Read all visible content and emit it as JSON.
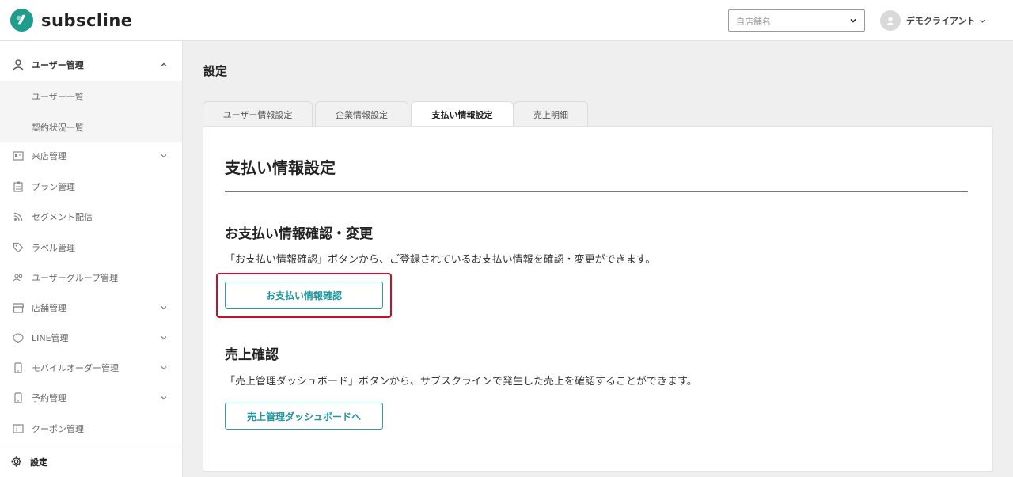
{
  "app": {
    "brand": "subscline",
    "brand_color": "#1f9c8c"
  },
  "header": {
    "store_select_placeholder": "自店舗名",
    "user_name": "デモクライアント"
  },
  "sidebar": {
    "items": [
      {
        "label": "ユーザー管理",
        "icon": "person-icon",
        "expanded": true
      },
      {
        "label": "ユーザー一覧",
        "sub": true
      },
      {
        "label": "契約状況一覧",
        "sub": true
      },
      {
        "label": "来店管理",
        "icon": "id-card-icon",
        "has_children": true
      },
      {
        "label": "プラン管理",
        "icon": "clipboard-icon"
      },
      {
        "label": "セグメント配信",
        "icon": "rss-icon"
      },
      {
        "label": "ラベル管理",
        "icon": "tag-icon"
      },
      {
        "label": "ユーザーグループ管理",
        "icon": "group-icon"
      },
      {
        "label": "店舗管理",
        "icon": "store-icon",
        "has_children": true
      },
      {
        "label": "LINE管理",
        "icon": "chat-icon",
        "has_children": true
      },
      {
        "label": "モバイルオーダー管理",
        "icon": "phone-icon",
        "has_children": true
      },
      {
        "label": "予約管理",
        "icon": "phone-icon",
        "has_children": true
      },
      {
        "label": "クーポン管理",
        "icon": "ticket-icon"
      },
      {
        "label": "設定",
        "icon": "gear-icon",
        "active": true
      }
    ]
  },
  "main": {
    "page_title": "設定",
    "tabs": [
      {
        "label": "ユーザー情報設定"
      },
      {
        "label": "企業情報設定"
      },
      {
        "label": "支払い情報設定",
        "active": true
      },
      {
        "label": "売上明細"
      }
    ],
    "panel_title": "支払い情報設定",
    "sections": [
      {
        "title": "お支払い情報確認・変更",
        "description": "「お支払い情報確認」ボタンから、ご登録されているお支払い情報を確認・変更ができます。",
        "button_label": "お支払い情報確認"
      },
      {
        "title": "売上確認",
        "description": "「売上管理ダッシュボード」ボタンから、サブスクラインで発生した売上を確認することができます。",
        "button_label": "売上管理ダッシュボードへ"
      }
    ],
    "accent_color": "#26a0a8",
    "highlight_color": "#c8102e"
  }
}
